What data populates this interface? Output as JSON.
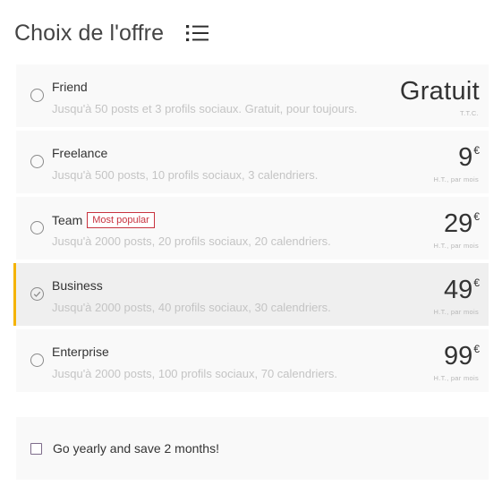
{
  "header": {
    "title": "Choix de l'offre",
    "menu_icon": "list-icon"
  },
  "plans": [
    {
      "name": "Friend",
      "badge": "",
      "description": "Jusqu'à 50 posts et 3 profils sociaux. Gratuit, pour toujours.",
      "price": "Gratuit",
      "currency": "",
      "price_note": "T.T.C.",
      "selected": false
    },
    {
      "name": "Freelance",
      "badge": "",
      "description": "Jusqu'à 500 posts, 10 profils sociaux, 3 calendriers.",
      "price": "9",
      "currency": "€",
      "price_note": "H.T., par mois",
      "selected": false
    },
    {
      "name": "Team",
      "badge": "Most popular",
      "description": "Jusqu'à 2000 posts, 20 profils sociaux, 20 calendriers.",
      "price": "29",
      "currency": "€",
      "price_note": "H.T., par mois",
      "selected": false
    },
    {
      "name": "Business",
      "badge": "",
      "description": "Jusqu'à 2000 posts, 40 profils sociaux, 30 calendriers.",
      "price": "49",
      "currency": "€",
      "price_note": "H.T., par mois",
      "selected": true
    },
    {
      "name": "Enterprise",
      "badge": "",
      "description": "Jusqu'à 2000 posts, 100 profils sociaux, 70 calendriers.",
      "price": "99",
      "currency": "€",
      "price_note": "H.T., par mois",
      "selected": false
    }
  ],
  "yearly": {
    "label": "Go yearly and save 2 months!",
    "checked": false
  },
  "colors": {
    "accent": "#f5b301",
    "badge": "#c8333f",
    "card_bg": "#f9f9f9",
    "selected_bg": "#efefef"
  }
}
